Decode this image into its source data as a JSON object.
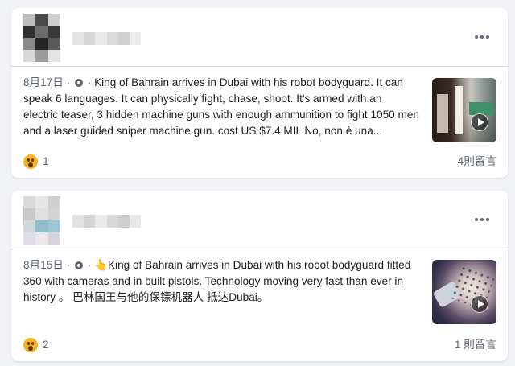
{
  "posts": [
    {
      "date": "8月17日",
      "separator": "·",
      "text": "King of Bahrain arrives in Dubai with his robot bodyguard. It can speak 6 languages. It can physically fight, chase, shoot. It's armed with an electric teaser, 3 hidden machine guns with enough ammunition to fight 1050 men and a laser guided sniper machine gun. cost US $7.4 MIL No, non è una...",
      "reaction_count": "1",
      "comment_count": "4則留言",
      "icons": {
        "privacy": "globe-icon",
        "reaction": "wow-icon",
        "more": "more-icon",
        "media": "play-icon"
      }
    },
    {
      "date": "8月15日",
      "separator": "·",
      "text": "👆King of Bahrain arrives in Dubai with his robot bodyguard fitted 360 with cameras and in built pistols. Technology moving very fast than ever in history 。 巴林国王与他的保镖机器人 抵达Dubai。",
      "reaction_count": "2",
      "comment_count": "1 則留言",
      "icons": {
        "privacy": "globe-icon",
        "reaction": "wow-icon",
        "more": "more-icon",
        "media": "play-icon"
      }
    }
  ],
  "colors": {
    "background": "#f0f2f5",
    "card": "#ffffff",
    "text_primary": "#1c1e21",
    "text_secondary": "#606770",
    "wow_yellow": "#f7b125"
  }
}
